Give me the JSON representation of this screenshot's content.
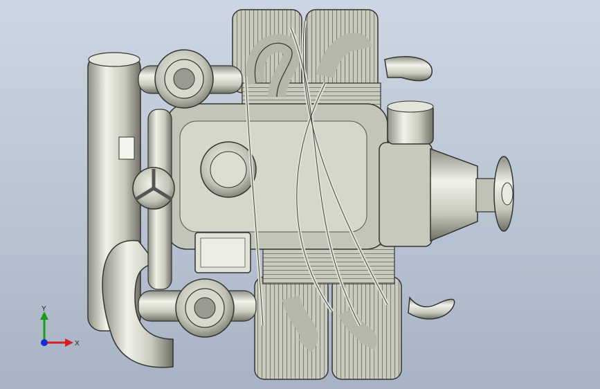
{
  "viewport": {
    "background_top": "#cdd6e2",
    "background_bottom": "#a7b3c4",
    "model_fill": "#d4d4c8",
    "model_edge": "#3a3a34"
  },
  "triad": {
    "x_label": "X",
    "y_label": "Y",
    "x_color": "#d42020",
    "y_color": "#1a9a1a",
    "z_color": "#1a2ad8"
  }
}
